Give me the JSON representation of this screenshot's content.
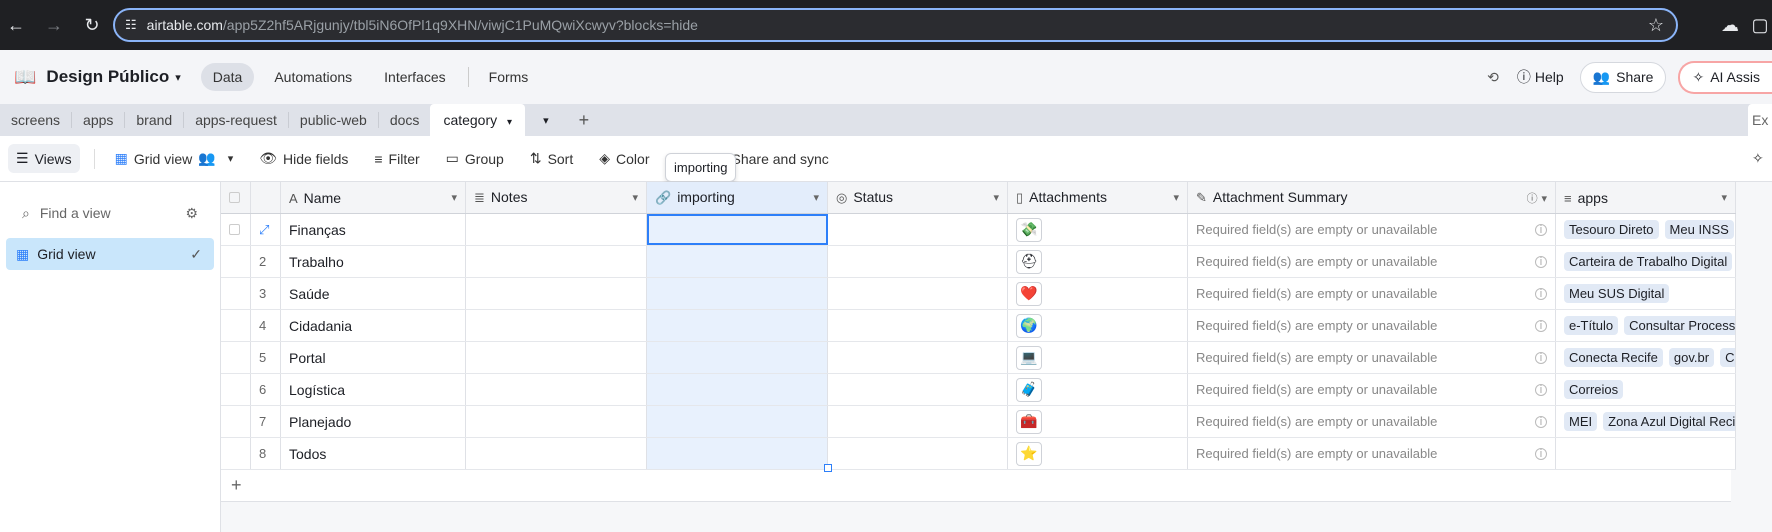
{
  "browser": {
    "url_host": "airtable.com",
    "url_path": "/app5Z2hf5ARjgunjy/tbl5iN6OfPl1q9XHN/viwjC1PuMQwiXcwyv?blocks=hide"
  },
  "header": {
    "base_name": "Design Público",
    "nav": [
      "Data",
      "Automations",
      "Interfaces",
      "Forms"
    ],
    "help": "Help",
    "share": "Share",
    "ai": "AI Assis"
  },
  "tabs": [
    "screens",
    "apps",
    "brand",
    "apps-request",
    "public-web",
    "docs",
    "category"
  ],
  "toolbar": {
    "views": "Views",
    "grid_view": "Grid view",
    "hide_fields": "Hide fields",
    "filter": "Filter",
    "group": "Group",
    "sort": "Sort",
    "color": "Color",
    "share_sync": "Share and sync",
    "tooltip": "importing"
  },
  "sidebar": {
    "find_placeholder": "Find a view",
    "view_item": "Grid view"
  },
  "columns": [
    "Name",
    "Notes",
    "importing",
    "Status",
    "Attachments",
    "Attachment Summary",
    "apps"
  ],
  "required_text": "Required field(s) are empty or unavailable",
  "rows": [
    {
      "num": "",
      "name": "Finanças",
      "att": "💸",
      "apps": [
        "Tesouro Direto",
        "Meu INSS"
      ]
    },
    {
      "num": "2",
      "name": "Trabalho",
      "att": "⛑",
      "apps": [
        "Carteira de Trabalho Digital"
      ]
    },
    {
      "num": "3",
      "name": "Saúde",
      "att": "❤️",
      "apps": [
        "Meu SUS Digital"
      ]
    },
    {
      "num": "4",
      "name": "Cidadania",
      "att": "🌍",
      "apps": [
        "e-Título",
        "Consultar Processo"
      ]
    },
    {
      "num": "5",
      "name": "Portal",
      "att": "💻",
      "apps": [
        "Conecta Recife",
        "gov.br",
        "Ca"
      ]
    },
    {
      "num": "6",
      "name": "Logística",
      "att": "🧳",
      "apps": [
        "Correios"
      ]
    },
    {
      "num": "7",
      "name": "Planejado",
      "att": "🧰",
      "apps": [
        "MEI",
        "Zona Azul Digital Recife"
      ]
    },
    {
      "num": "8",
      "name": "Todos",
      "att": "⭐",
      "apps": []
    }
  ]
}
